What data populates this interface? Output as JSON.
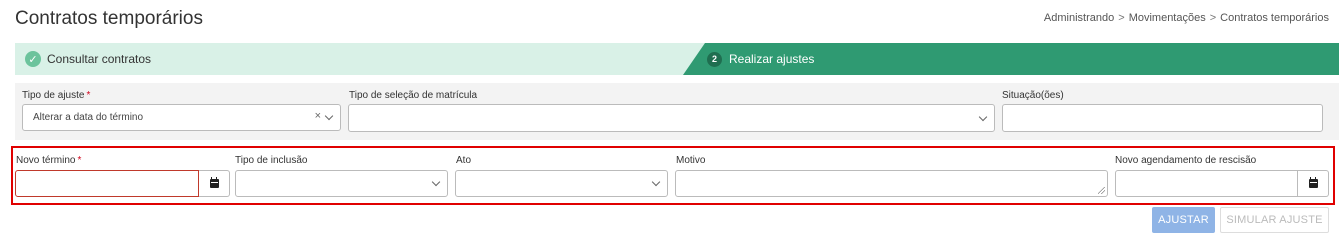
{
  "page": {
    "title": "Contratos temporários"
  },
  "breadcrumb": {
    "items": [
      "Administrando",
      "Movimentações",
      "Contratos temporários"
    ],
    "separator": ">"
  },
  "steps": {
    "step1": {
      "label": "Consultar contratos",
      "status": "completed",
      "icon": "check-icon"
    },
    "step2": {
      "number": "2",
      "label": "Realizar ajustes",
      "status": "active"
    }
  },
  "colors": {
    "step_done_bg": "#d9f1e7",
    "step_active_bg": "#2f9a72",
    "highlight_border": "#e00000",
    "primary_button": "#8fb4e6"
  },
  "filters": {
    "tipo_ajuste": {
      "label": "Tipo de ajuste",
      "required": "*",
      "value": "Alterar a data do término"
    },
    "tipo_selecao": {
      "label": "Tipo de seleção de matrícula",
      "value": ""
    },
    "situacao": {
      "label": "Situação(ões)",
      "value": ""
    }
  },
  "adjust_fields": {
    "novo_termino": {
      "label": "Novo término",
      "required": "*",
      "value": ""
    },
    "tipo_inclusao": {
      "label": "Tipo de inclusão",
      "value": ""
    },
    "ato": {
      "label": "Ato",
      "value": ""
    },
    "motivo": {
      "label": "Motivo",
      "value": ""
    },
    "novo_agendamento": {
      "label": "Novo agendamento de rescisão",
      "value": ""
    }
  },
  "actions": {
    "ajustar": "AJUSTAR",
    "simular": "SIMULAR AJUSTE"
  }
}
